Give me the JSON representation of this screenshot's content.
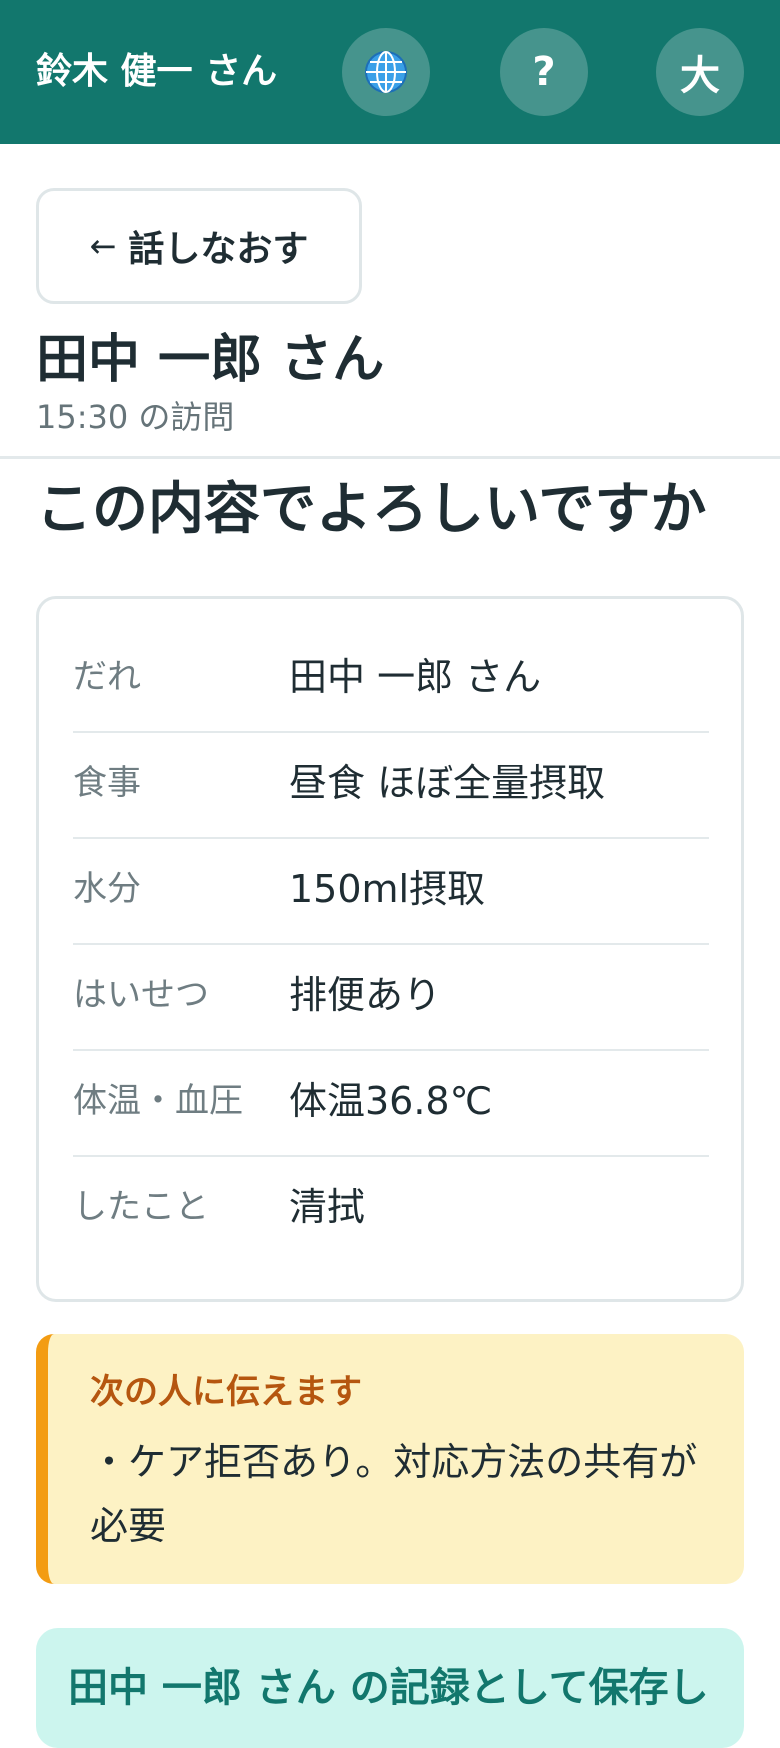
{
  "header": {
    "user_name": "鈴木 健一 さん",
    "help_label": "?",
    "size_label": "大",
    "accent_color": "#12776d"
  },
  "back_button": {
    "arrow": "←",
    "label": "話しなおす"
  },
  "client": {
    "name": "田中 一郎 さん",
    "visit_time": "15:30 の訪問"
  },
  "confirm": {
    "title": "この内容でよろしいですか"
  },
  "record": {
    "rows": [
      {
        "label": "だれ",
        "value": "田中 一郎 さん"
      },
      {
        "label": "食事",
        "value": "昼食 ほぼ全量摂取"
      },
      {
        "label": "水分",
        "value": "150ml摂取"
      },
      {
        "label": "はいせつ",
        "value": "排便あり"
      },
      {
        "label": "体温・血圧",
        "value": "体温36.8℃"
      },
      {
        "label": "したこと",
        "value": "清拭"
      }
    ]
  },
  "handover": {
    "title": "次の人に伝えます",
    "body": "・ケア拒否あり。対応方法の共有が必要"
  },
  "save": {
    "label": "田中 一郎 さん の記録として保存し"
  }
}
